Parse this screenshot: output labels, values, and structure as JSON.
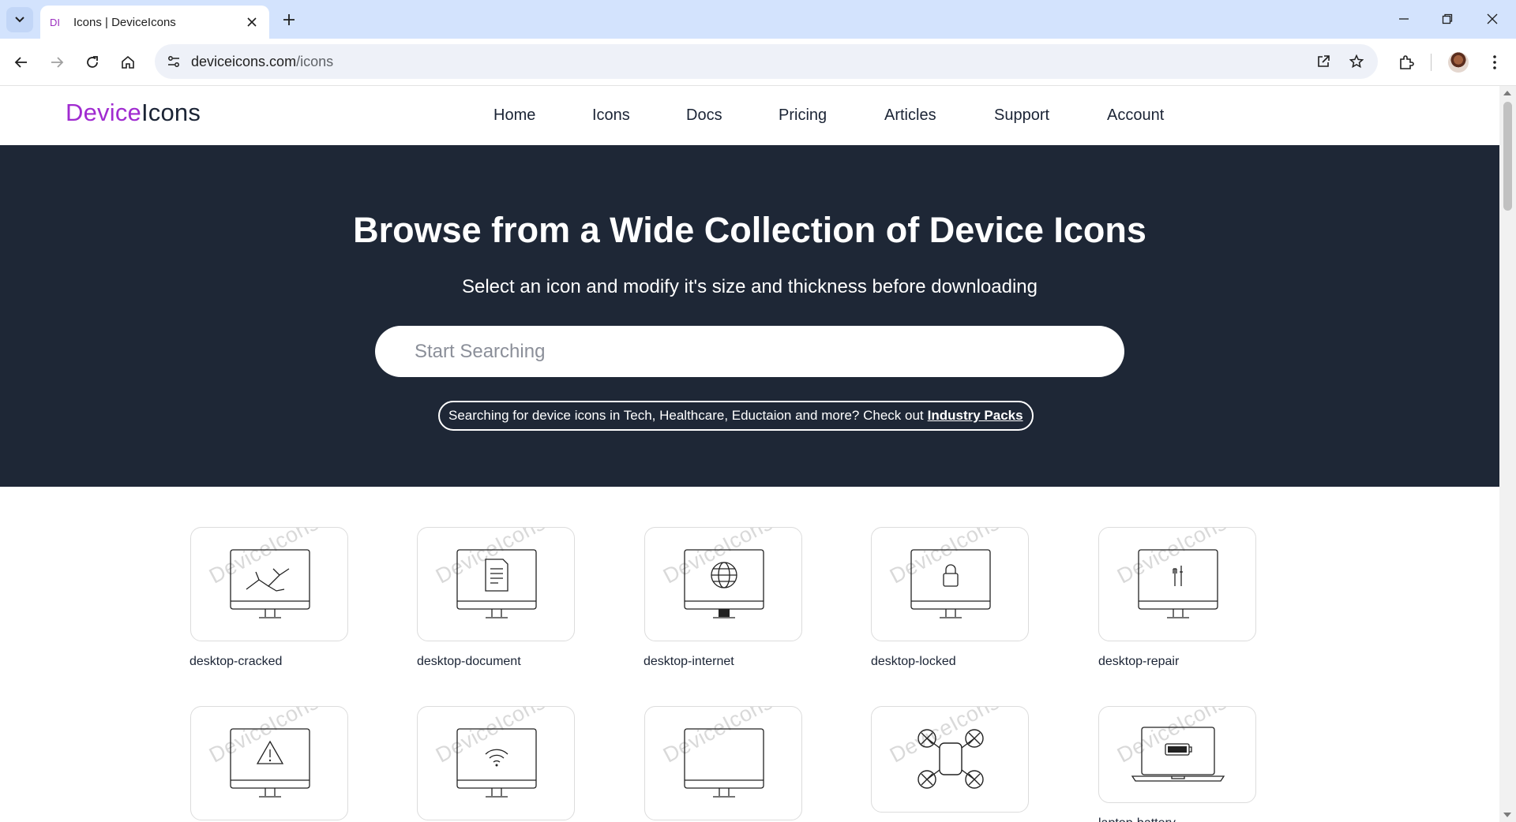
{
  "browser": {
    "tab_title": "Icons | DeviceIcons",
    "favicon_text": "DI",
    "url_host": "deviceicons.com",
    "url_path": "/icons",
    "icons": [
      "tab-list-icon",
      "close-icon",
      "plus-icon",
      "minimize-icon",
      "restore-icon",
      "close-window-icon",
      "back-icon",
      "forward-icon",
      "reload-icon",
      "home-icon",
      "site-info-icon",
      "open-in-app-icon",
      "star-icon",
      "extensions-icon",
      "more-icon"
    ]
  },
  "site": {
    "logo_part1": "Device",
    "logo_part2": "Icons",
    "logo_colors": {
      "accent": "#a02bd0",
      "dark": "#1b2435"
    },
    "nav": [
      "Home",
      "Icons",
      "Docs",
      "Pricing",
      "Articles",
      "Support",
      "Account"
    ]
  },
  "hero": {
    "title": "Browse from a Wide Collection of Device Icons",
    "subtitle": "Select an icon and modify it's size and thickness before downloading",
    "search_placeholder": "Start Searching",
    "packs_text": "Searching for device icons in Tech, Healthcare, Eductaion and more? Check out",
    "packs_link": "Industry Packs",
    "background": "#1e2736"
  },
  "watermark": "DeviceIcons",
  "icons": [
    {
      "label": "desktop-cracked",
      "glyph": "desktop-cracked-icon"
    },
    {
      "label": "desktop-document",
      "glyph": "desktop-document-icon"
    },
    {
      "label": "desktop-internet",
      "glyph": "desktop-internet-icon"
    },
    {
      "label": "desktop-locked",
      "glyph": "desktop-locked-icon"
    },
    {
      "label": "desktop-repair",
      "glyph": "desktop-repair-icon"
    },
    {
      "label": "",
      "glyph": "desktop-warning-icon"
    },
    {
      "label": "",
      "glyph": "desktop-wifi-icon"
    },
    {
      "label": "",
      "glyph": "desktop-icon"
    },
    {
      "label": "",
      "glyph": "drone-icon"
    },
    {
      "label": "laptop-battery",
      "glyph": "laptop-battery-icon"
    }
  ]
}
